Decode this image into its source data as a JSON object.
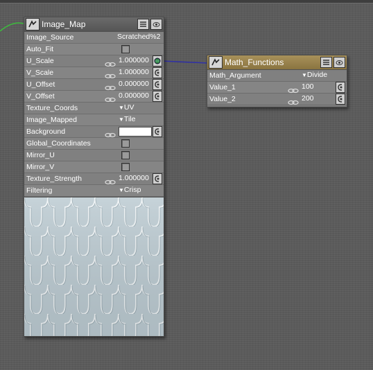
{
  "image_map": {
    "title": "Image_Map",
    "rows": [
      {
        "label": "Image_Source",
        "kind": "text",
        "value": "Scratched%2"
      },
      {
        "label": "Auto_Fit",
        "kind": "check"
      },
      {
        "label": "U_Scale",
        "kind": "num",
        "value": "1.000000"
      },
      {
        "label": "V_Scale",
        "kind": "num",
        "value": "1.000000"
      },
      {
        "label": "U_Offset",
        "kind": "num",
        "value": "0.000000"
      },
      {
        "label": "V_Offset",
        "kind": "num",
        "value": "0.000000"
      },
      {
        "label": "Texture_Coords",
        "kind": "dd",
        "value": "UV"
      },
      {
        "label": "Image_Mapped",
        "kind": "dd",
        "value": "Tile"
      },
      {
        "label": "Background",
        "kind": "color",
        "color": "#ffffff"
      },
      {
        "label": "Global_Coordinates",
        "kind": "check"
      },
      {
        "label": "Mirror_U",
        "kind": "check"
      },
      {
        "label": "Mirror_V",
        "kind": "check"
      },
      {
        "label": "Texture_Strength",
        "kind": "num",
        "value": "1.000000"
      },
      {
        "label": "Filtering",
        "kind": "dd",
        "value": "Crisp"
      }
    ],
    "preview_color": "#b9c8cf"
  },
  "math_functions": {
    "title": "Math_Functions",
    "rows": [
      {
        "label": "Math_Argument",
        "kind": "dd",
        "value": "Divide"
      },
      {
        "label": "Value_1",
        "kind": "num",
        "value": "100"
      },
      {
        "label": "Value_2",
        "kind": "num",
        "value": "200"
      }
    ]
  },
  "colors": {
    "wire_input": "#3dbd3d",
    "wire_output": "#2e2ea8",
    "header_gold": "#9a844e",
    "node_body": "#808080"
  },
  "icons": {
    "node_icon": "poser-node-icon",
    "preview_toggle": "preview-toggle-icon",
    "eye_toggle": "eye-toggle-icon",
    "link": "link-chain-icon",
    "socket": "input-socket-icon"
  }
}
